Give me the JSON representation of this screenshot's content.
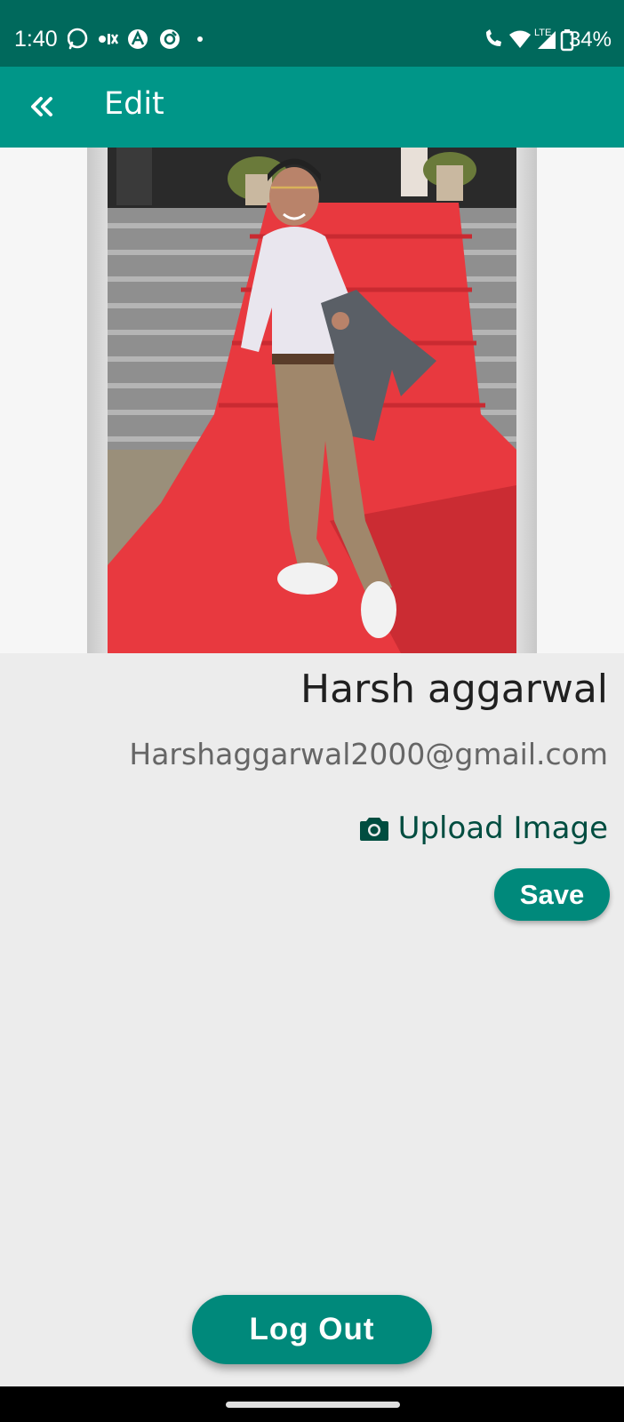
{
  "status_bar": {
    "time": "1:40",
    "network_label": "LTE",
    "battery_percent": "34%",
    "icons_left": [
      "whatsapp-icon",
      "olx-icon",
      "app-a-icon",
      "app-circle-icon",
      "dot-icon"
    ],
    "icons_right": [
      "wifi-calling-icon",
      "wifi-icon",
      "signal-icon",
      "battery-icon"
    ]
  },
  "app_bar": {
    "back_icon": "double-chevron-left-icon",
    "title": "Edit",
    "color": "#009688"
  },
  "profile": {
    "photo": "profile-photo",
    "name": "Harsh aggarwal",
    "email": "Harshaggarwal2000@gmail.com",
    "upload_icon": "camera-icon",
    "upload_label": "Upload Image",
    "save_label": "Save"
  },
  "logout_label": "Log Out",
  "colors": {
    "primary": "#009688",
    "primary_dark": "#00695c",
    "button": "#00897b",
    "upload_text": "#004d40"
  }
}
